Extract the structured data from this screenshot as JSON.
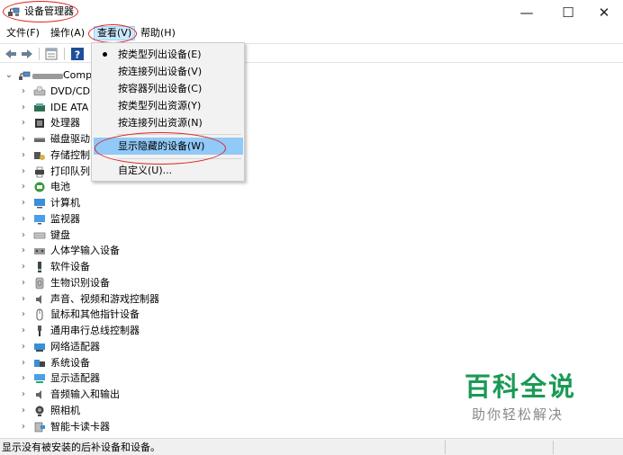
{
  "window": {
    "title": "设备管理器",
    "minimize_glyph": "—",
    "maximize_glyph": "☐",
    "close_glyph": "✕"
  },
  "menubar": {
    "file": "文件(F)",
    "action": "操作(A)",
    "view": "查看(V)",
    "help": "帮助(H)"
  },
  "view_menu": {
    "items": [
      {
        "label": "按类型列出设备(E)",
        "checked": true
      },
      {
        "label": "按连接列出设备(V)",
        "checked": false
      },
      {
        "label": "按容器列出设备(C)",
        "checked": false
      },
      {
        "label": "按类型列出资源(Y)",
        "checked": false
      },
      {
        "label": "按连接列出资源(N)",
        "checked": false
      },
      {
        "label": "显示隐藏的设备(W)",
        "checked": false,
        "highlighted": true
      },
      {
        "label": "自定义(U)...",
        "checked": false
      }
    ]
  },
  "tree": {
    "root_label": "Comp",
    "nodes": [
      {
        "label": "DVD/CD",
        "icon": "dvd-drive-icon"
      },
      {
        "label": "IDE ATA",
        "icon": "ide-controller-icon"
      },
      {
        "label": "处理器",
        "icon": "processor-icon"
      },
      {
        "label": "磁盘驱动",
        "icon": "disk-drive-icon"
      },
      {
        "label": "存储控制",
        "icon": "storage-controller-icon"
      },
      {
        "label": "打印队列",
        "icon": "printer-icon"
      },
      {
        "label": "电池",
        "icon": "battery-icon"
      },
      {
        "label": "计算机",
        "icon": "computer-icon"
      },
      {
        "label": "监视器",
        "icon": "monitor-icon"
      },
      {
        "label": "键盘",
        "icon": "keyboard-icon"
      },
      {
        "label": "人体学输入设备",
        "icon": "hid-icon"
      },
      {
        "label": "软件设备",
        "icon": "software-device-icon"
      },
      {
        "label": "生物识别设备",
        "icon": "biometric-icon"
      },
      {
        "label": "声音、视频和游戏控制器",
        "icon": "speaker-icon"
      },
      {
        "label": "鼠标和其他指针设备",
        "icon": "mouse-icon"
      },
      {
        "label": "通用串行总线控制器",
        "icon": "usb-icon"
      },
      {
        "label": "网络适配器",
        "icon": "network-adapter-icon"
      },
      {
        "label": "系统设备",
        "icon": "system-device-icon"
      },
      {
        "label": "显示适配器",
        "icon": "display-adapter-icon"
      },
      {
        "label": "音频输入和输出",
        "icon": "audio-io-icon"
      },
      {
        "label": "照相机",
        "icon": "camera-icon"
      },
      {
        "label": "智能卡读卡器",
        "icon": "smart-card-reader-icon"
      }
    ]
  },
  "statusbar": {
    "text": "显示没有被安装的后补设备和设备。"
  },
  "watermark": {
    "title": "百科全说",
    "subtitle": "助你轻松解决"
  },
  "colors": {
    "menu_highlight": "#cce8ff",
    "dropdown_highlight": "#91c9f7",
    "annotation_red": "#e02020",
    "watermark_green": "#1a9a55"
  }
}
